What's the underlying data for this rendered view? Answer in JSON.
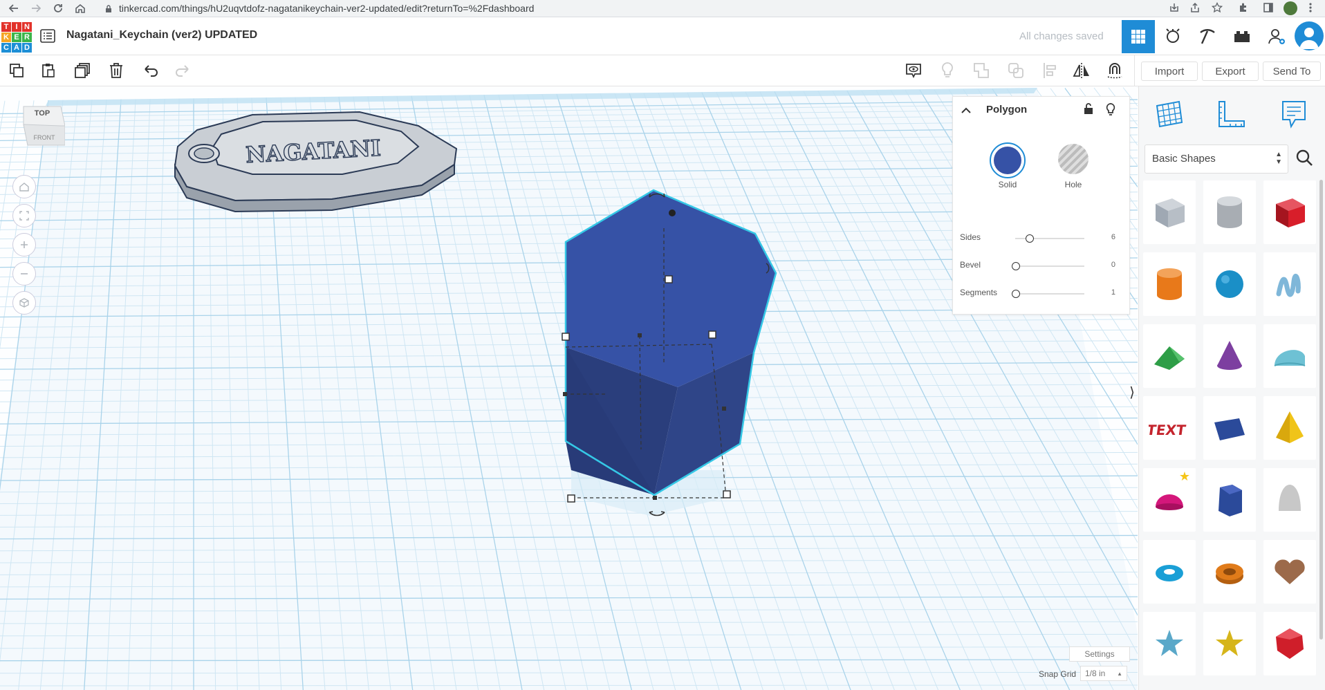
{
  "browser": {
    "url": "tinkercad.com/things/hU2uqvtdofz-nagatanikeychain-ver2-updated/edit?returnTo=%2Fdashboard"
  },
  "logo": {
    "letters": [
      "T",
      "I",
      "N",
      "K",
      "E",
      "R",
      "C",
      "A",
      "D"
    ]
  },
  "header": {
    "title": "Nagatani_Keychain (ver2) UPDATED",
    "save_status": "All changes saved"
  },
  "toolbar": {
    "import_label": "Import",
    "export_label": "Export",
    "send_to_label": "Send To"
  },
  "view_cube": {
    "top": "TOP",
    "front": "FRONT"
  },
  "scene": {
    "keychain_text": "NAGATANI"
  },
  "inspector": {
    "title": "Polygon",
    "solid_label": "Solid",
    "hole_label": "Hole",
    "params": [
      {
        "label": "Sides",
        "value": "6",
        "fraction": 0.2
      },
      {
        "label": "Bevel",
        "value": "0",
        "fraction": 0.0
      },
      {
        "label": "Segments",
        "value": "1",
        "fraction": 0.0
      }
    ]
  },
  "shapes_panel": {
    "category": "Basic Shapes",
    "shapes": [
      {
        "name": "box-hole",
        "color": "#9fa8b3"
      },
      {
        "name": "cylinder-hole",
        "color": "#a8adb3"
      },
      {
        "name": "box",
        "color": "#d81e2a"
      },
      {
        "name": "cylinder",
        "color": "#e8791a"
      },
      {
        "name": "sphere",
        "color": "#1a8fc7"
      },
      {
        "name": "scribble",
        "color": "#7fb7d9"
      },
      {
        "name": "roof",
        "color": "#2e9e47"
      },
      {
        "name": "cone",
        "color": "#7d3fa0"
      },
      {
        "name": "round-roof",
        "color": "#6ec1d4"
      },
      {
        "name": "text",
        "color": "#c4242d"
      },
      {
        "name": "wedge",
        "color": "#2b4a9a"
      },
      {
        "name": "pyramid",
        "color": "#f0c419"
      },
      {
        "name": "half-sphere",
        "color": "#d4177b"
      },
      {
        "name": "polygon",
        "color": "#2b4a9a"
      },
      {
        "name": "paraboloid",
        "color": "#c8c8c8"
      },
      {
        "name": "torus",
        "color": "#1a9fd6"
      },
      {
        "name": "tube",
        "color": "#e07b1a"
      },
      {
        "name": "heart",
        "color": "#9c6a4a"
      },
      {
        "name": "star",
        "color": "#5aa8c9"
      },
      {
        "name": "star-gold",
        "color": "#d6b51a"
      },
      {
        "name": "icosahedron",
        "color": "#cf1e2a"
      }
    ]
  },
  "bottom": {
    "settings_label": "Settings",
    "snap_grid_label": "Snap Grid",
    "snap_grid_value": "1/8 in"
  },
  "colors": {
    "solid": "#3652a6",
    "accent": "#1f8cd6",
    "selection": "#35c8e6"
  }
}
